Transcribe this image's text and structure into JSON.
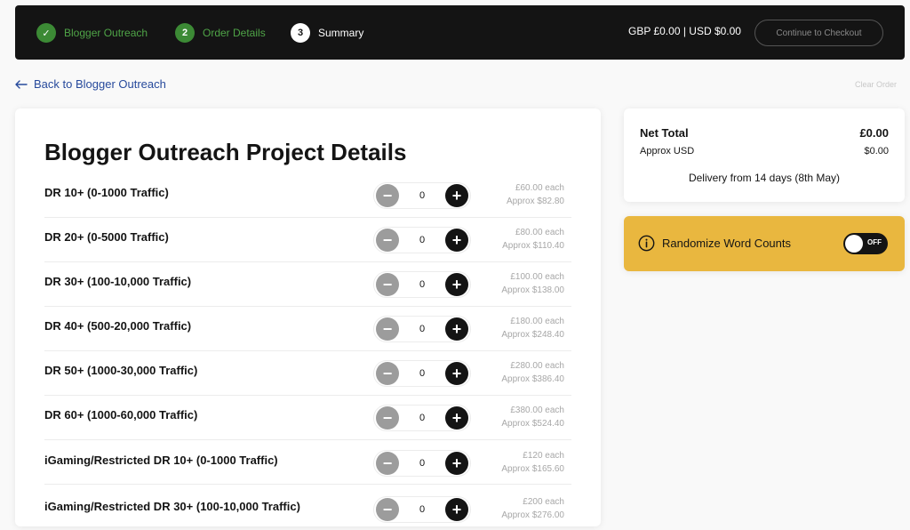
{
  "steps": [
    {
      "label": "Blogger Outreach",
      "marker": "✓",
      "state": "done"
    },
    {
      "label": "Order Details",
      "marker": "2",
      "state": "done"
    },
    {
      "label": "Summary",
      "marker": "3",
      "state": "current"
    }
  ],
  "header": {
    "currency_summary": "GBP £0.00 | USD $0.00",
    "checkout_label": "Continue to Checkout"
  },
  "back_link": "Back to Blogger Outreach",
  "clear_order": "Clear Order",
  "project": {
    "title": "Blogger Outreach Project Details",
    "items": [
      {
        "name": "DR 10+ (0-1000 Traffic)",
        "qty": "0",
        "price_gbp": "£60.00 each",
        "price_usd": "Approx $82.80"
      },
      {
        "name": "DR 20+ (0-5000 Traffic)",
        "qty": "0",
        "price_gbp": "£80.00 each",
        "price_usd": "Approx $110.40"
      },
      {
        "name": "DR 30+ (100-10,000 Traffic)",
        "qty": "0",
        "price_gbp": "£100.00 each",
        "price_usd": "Approx $138.00"
      },
      {
        "name": "DR 40+ (500-20,000 Traffic)",
        "qty": "0",
        "price_gbp": "£180.00 each",
        "price_usd": "Approx $248.40"
      },
      {
        "name": "DR 50+ (1000-30,000 Traffic)",
        "qty": "0",
        "price_gbp": "£280.00 each",
        "price_usd": "Approx $386.40"
      },
      {
        "name": "DR 60+ (1000-60,000 Traffic)",
        "qty": "0",
        "price_gbp": "£380.00 each",
        "price_usd": "Approx $524.40"
      },
      {
        "name": "iGaming/Restricted DR 10+ (0-1000 Traffic)",
        "qty": "0",
        "price_gbp": "£120 each",
        "price_usd": "Approx $165.60"
      },
      {
        "name": "iGaming/Restricted DR 30+ (100-10,000 Traffic)",
        "qty": "0",
        "price_gbp": "£200 each",
        "price_usd": "Approx $276.00"
      }
    ]
  },
  "summary": {
    "net_total_label": "Net Total",
    "net_total_value": "£0.00",
    "approx_usd_label": "Approx USD",
    "approx_usd_value": "$0.00",
    "delivery": "Delivery from 14 days (8th May)"
  },
  "randomize": {
    "label": "Randomize Word Counts",
    "toggle_text": "OFF",
    "enabled": false
  },
  "colors": {
    "header_bg": "#141414",
    "step_done": "#3c8a35",
    "link": "#274a9c",
    "randomize_bg": "#e9b73f"
  }
}
